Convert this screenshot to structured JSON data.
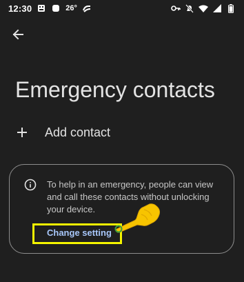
{
  "status_bar": {
    "time": "12:30",
    "temperature": "26°",
    "left_icons": [
      "sim-icon",
      "app-icon",
      "weather-icon",
      "cast-icon"
    ],
    "right_icons": [
      "vpn-key-icon",
      "mute-icon",
      "wifi-icon",
      "signal-icon",
      "battery-icon"
    ]
  },
  "header": {
    "back_icon": "arrow-back-icon",
    "title": "Emergency contacts"
  },
  "add_contact": {
    "icon": "plus-icon",
    "label": "Add contact"
  },
  "info_card": {
    "icon": "info-icon",
    "text": "To help in an emergency, people can view and call these contacts without unlocking your device.",
    "link_label": "Change setting"
  },
  "annotation": {
    "highlight_color": "#f5f500",
    "pointer_color": "#f7c400"
  },
  "colors": {
    "background": "#1f1f1f",
    "text_primary": "#e3e3e3",
    "text_secondary": "#c7c7c7",
    "link": "#a8c7fa",
    "card_border": "#8e8e8e"
  }
}
